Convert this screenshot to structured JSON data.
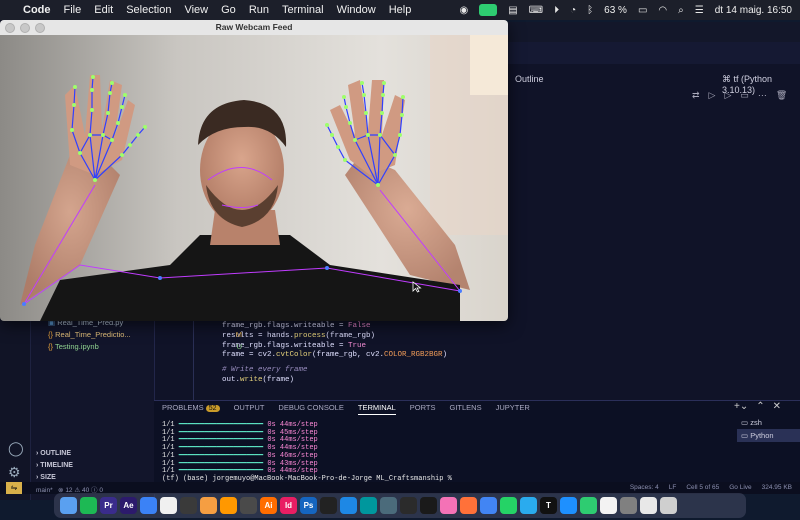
{
  "menubar": {
    "app_name": "Code",
    "items": [
      "File",
      "Edit",
      "Selection",
      "View",
      "Go",
      "Run",
      "Terminal",
      "Window",
      "Help"
    ],
    "battery": "63 %",
    "datetime": "dt 14 maig. 16:50"
  },
  "webcam_window": {
    "title": "Raw Webcam Feed"
  },
  "editor": {
    "outline_label": "Outline",
    "kernel_label": "tf (Python 3.10.13)",
    "code_lines": [
      {
        "a": "frame_rgb.flags.writeable = ",
        "b": "False"
      },
      {
        "a": "results = hands.",
        "m": "process",
        "c": "(frame_rgb)"
      },
      {
        "a": "frame_rgb.flags.writeable = ",
        "b": "True"
      },
      {
        "a": "frame = cv2.",
        "m": "cvtColor",
        "c": "(frame_rgb, cv2.",
        "k": "COLOR_RGB2BGR",
        "d": ")"
      },
      {
        "comment": "# Write every frame"
      },
      {
        "a": "out.",
        "m": "write",
        "c": "(frame)"
      }
    ]
  },
  "explorer": {
    "files": [
      {
        "name": "Real_Time_Pred.py",
        "badge": ""
      },
      {
        "name": "Real_Time_Predictio...",
        "badge": "M"
      },
      {
        "name": "Testing.ipynb",
        "badge": "U"
      }
    ],
    "sections": [
      "OUTLINE",
      "TIMELINE",
      "SIZE"
    ]
  },
  "panel": {
    "tabs": [
      "PROBLEMS",
      "OUTPUT",
      "DEBUG CONSOLE",
      "TERMINAL",
      "PORTS",
      "GITLENS",
      "JUPYTER"
    ],
    "problems_count": "52",
    "active_tab": "TERMINAL",
    "terminal_lines": [
      {
        "step": "1/1",
        "time": "0s 44ms/step"
      },
      {
        "step": "1/1",
        "time": "0s 45ms/step"
      },
      {
        "step": "1/1",
        "time": "0s 44ms/step"
      },
      {
        "step": "1/1",
        "time": "0s 44ms/step"
      },
      {
        "step": "1/1",
        "time": "0s 46ms/step"
      },
      {
        "step": "1/1",
        "time": "0s 43ms/step"
      },
      {
        "step": "1/1",
        "time": "0s 44ms/step"
      }
    ],
    "prompt": "(tf) (base) jorgemuyo@MacBook-MacBook-Pro-de-Jorge ML_Craftsmanship %",
    "terminals": [
      "zsh",
      "Python"
    ]
  },
  "statusbar": {
    "branch": "main*",
    "errors": "12",
    "warnings": "40",
    "info": "0",
    "right": [
      "Spaces: 4",
      "LF",
      "Cell 5 of 65",
      "Go Live",
      "324.95 KB"
    ]
  },
  "dock": {
    "apps": [
      "finder-icon",
      "spotify-icon",
      "premiere-icon",
      "after-effects-icon",
      "curve-icon",
      "arc-icon",
      "cursor-icon",
      "blender-icon",
      "sublime-icon",
      "davinci-icon",
      "illustrator-icon",
      "indesign-icon",
      "photoshop-icon",
      "github-icon",
      "vscode-icon",
      "arduino-icon",
      "processing-icon",
      "touchdesigner-icon",
      "terminal-icon",
      "chatgpt-icon",
      "firefox-icon",
      "chrome-icon",
      "whatsapp-icon",
      "telegram-icon",
      "typora-icon",
      "appstore-icon",
      "numbers-icon",
      "notion-icon",
      "settings-icon",
      "document-icon",
      "trash-icon"
    ],
    "colors": [
      "#5aa0f0",
      "#1db954",
      "#3a2c8c",
      "#2c1a6c",
      "#3b82f6",
      "#f0f0f0",
      "#3a3a3a",
      "#f59e42",
      "#ff9800",
      "#4a4a4a",
      "#ff6d00",
      "#e91e63",
      "#1565c0",
      "#222222",
      "#1e88e5",
      "#00979d",
      "#4b6b7b",
      "#2b2b2b",
      "#1a1a1a",
      "#f472b6",
      "#ff7139",
      "#4285f4",
      "#25d366",
      "#2aabee",
      "#111111",
      "#1e90ff",
      "#2ecc71",
      "#f3f3f3",
      "#808080",
      "#e8e8e8",
      "#cfcfcf"
    ],
    "labels": [
      "",
      "",
      "Pr",
      "Ae",
      "",
      "",
      "",
      "",
      "",
      "",
      "Ai",
      "Id",
      "Ps",
      "",
      "",
      "",
      "",
      "",
      "",
      "",
      "",
      "",
      "",
      "",
      "T",
      "",
      "",
      "",
      "",
      "",
      ""
    ]
  }
}
